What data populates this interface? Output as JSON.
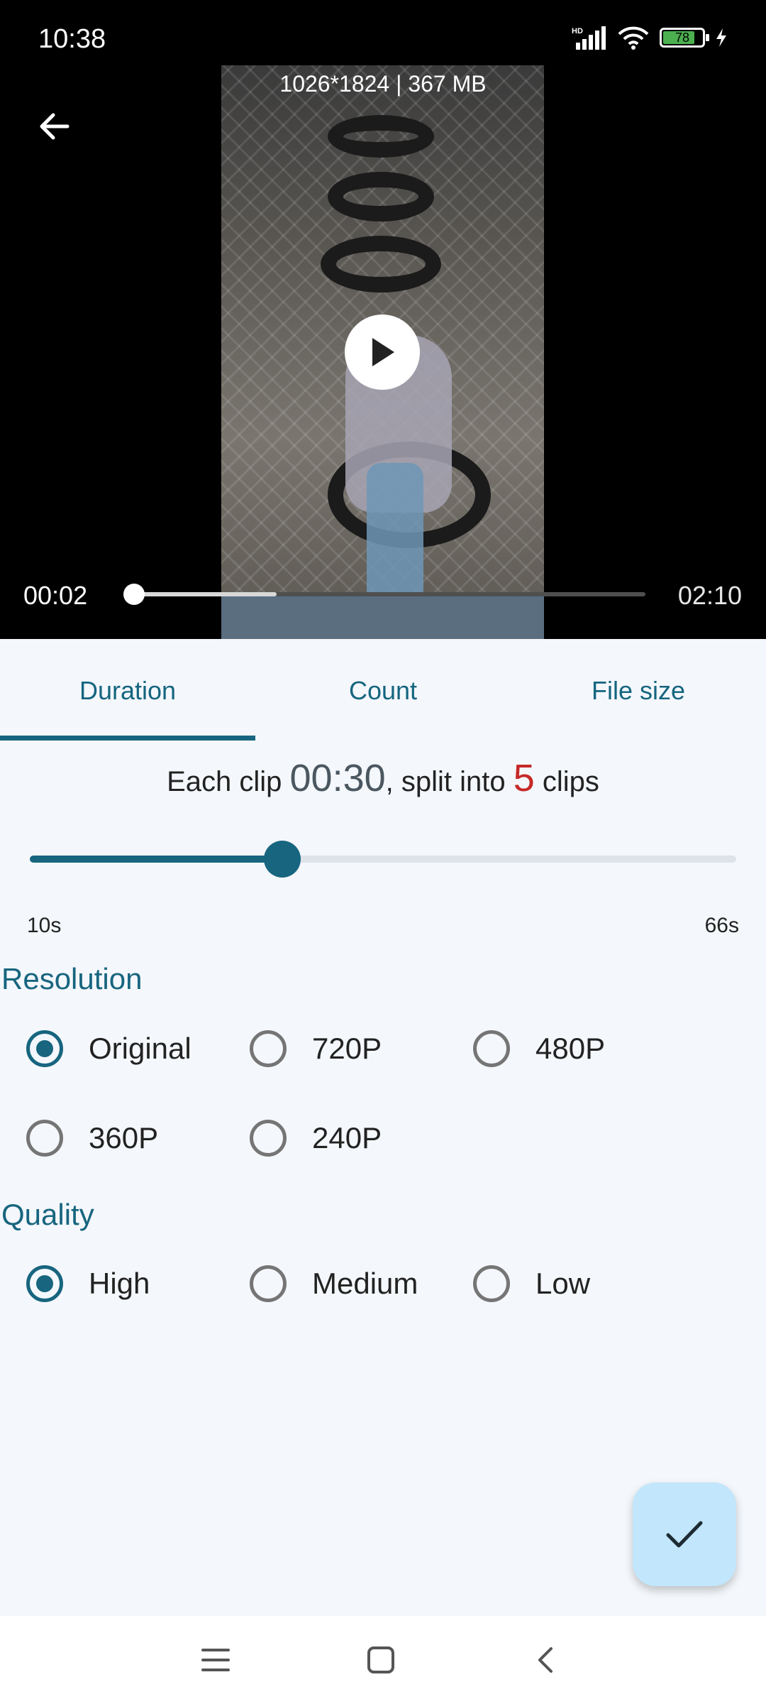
{
  "status_bar": {
    "time": "10:38",
    "network_label": "HD",
    "battery_level": "78"
  },
  "video": {
    "meta": "1026*1824 | 367 MB",
    "current_time": "00:02",
    "total_time": "02:10",
    "played_fraction": 0.0,
    "buffered_fraction": 0.28
  },
  "tabs": [
    {
      "label": "Duration",
      "selected": true
    },
    {
      "label": "Count",
      "selected": false
    },
    {
      "label": "File size",
      "selected": false
    }
  ],
  "summary": {
    "prefix": "Each clip ",
    "duration": "00:30",
    "middle": ", split into ",
    "count": "5",
    "suffix": " clips"
  },
  "slider": {
    "min_label": "10s",
    "max_label": "66s",
    "min": 10,
    "max": 66,
    "value": 30
  },
  "resolution": {
    "title": "Resolution",
    "options": [
      {
        "label": "Original",
        "checked": true
      },
      {
        "label": "720P",
        "checked": false
      },
      {
        "label": "480P",
        "checked": false
      },
      {
        "label": "360P",
        "checked": false
      },
      {
        "label": "240P",
        "checked": false
      }
    ]
  },
  "quality": {
    "title": "Quality",
    "options": [
      {
        "label": "High",
        "checked": true
      },
      {
        "label": "Medium",
        "checked": false
      },
      {
        "label": "Low",
        "checked": false
      }
    ]
  },
  "colors": {
    "accent": "#17657f",
    "clip_count": "#c62828",
    "fab": "#c2e6fb"
  },
  "icons": {
    "back": "arrow-left-icon",
    "play": "play-icon",
    "confirm": "check-icon",
    "nav_menu": "menu-icon",
    "nav_home": "home-icon",
    "nav_back": "chevron-left-icon"
  }
}
